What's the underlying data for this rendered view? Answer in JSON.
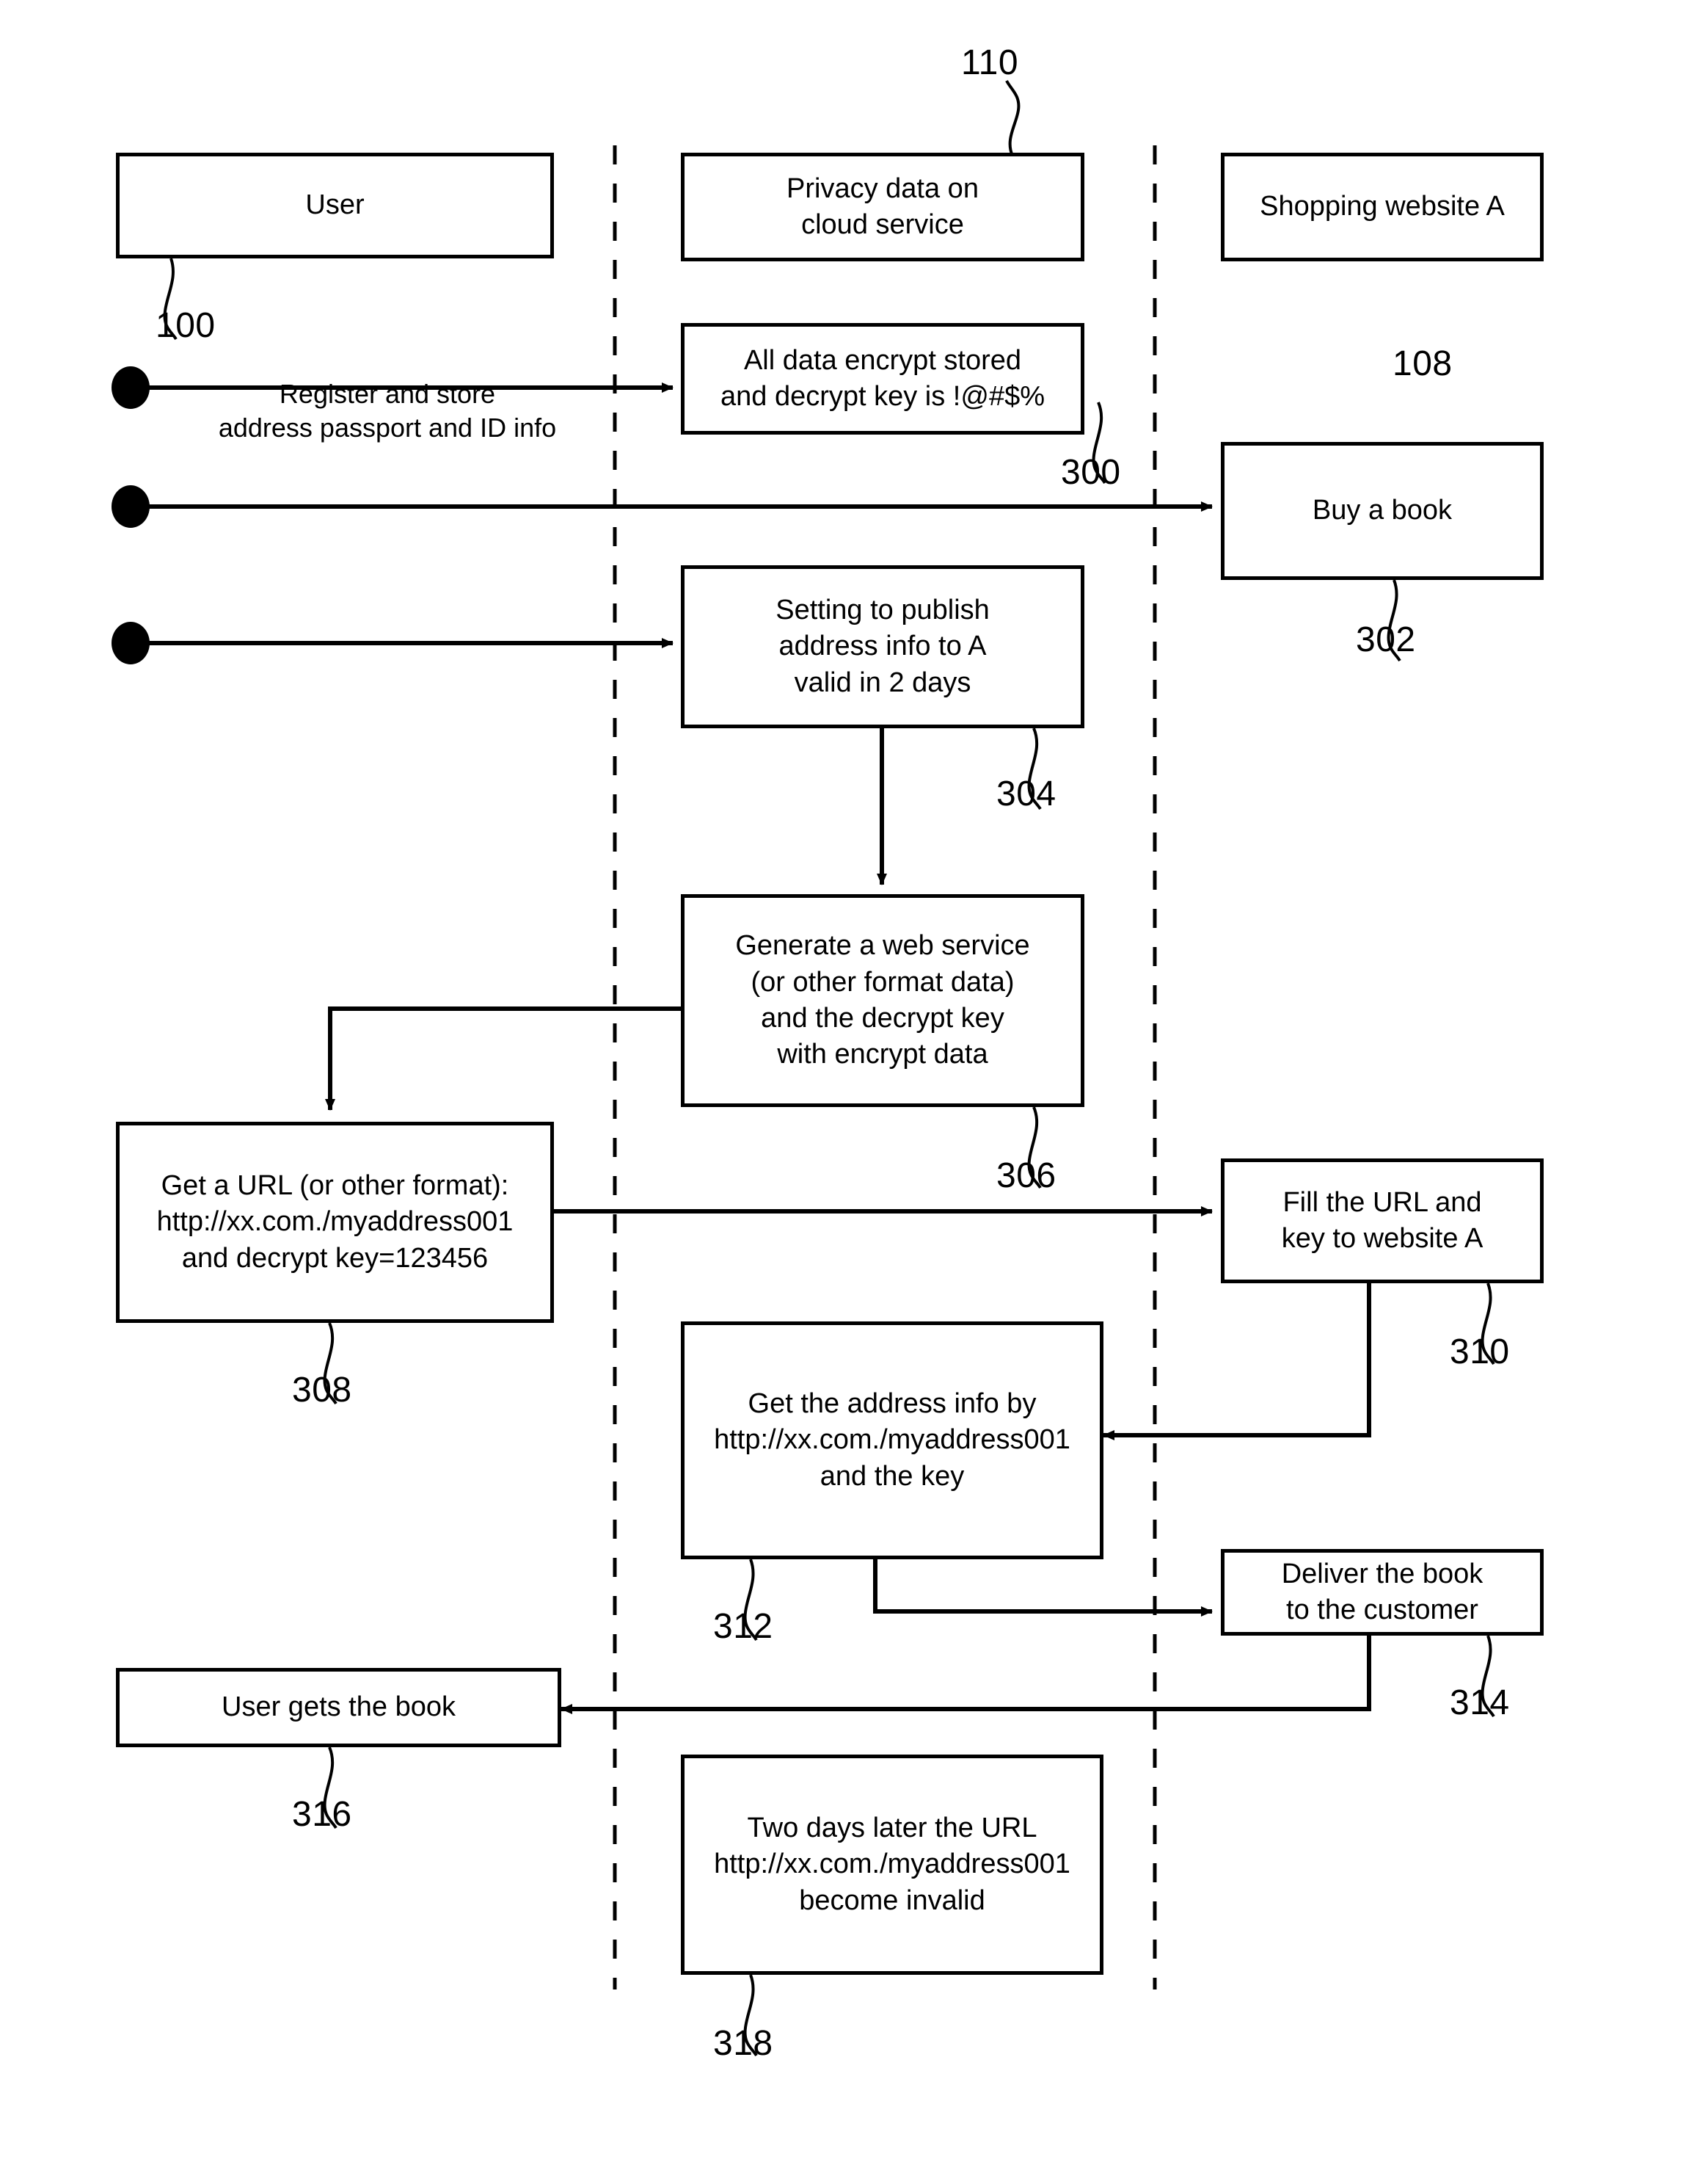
{
  "figure": {
    "type": "patent-flow-diagram",
    "lanes": [
      {
        "name": "user-lane",
        "label": "User"
      },
      {
        "name": "cloud-lane",
        "label": "Privacy data on\ncloud service"
      },
      {
        "name": "website-lane",
        "label": "Shopping website A"
      }
    ],
    "nodes": [
      {
        "id": "user",
        "label": "User",
        "ref": "100",
        "lane": "user-lane"
      },
      {
        "id": "privacy-data-cloud-service",
        "label": "Privacy data on\ncloud service",
        "ref": "110",
        "lane": "cloud-lane"
      },
      {
        "id": "shopping-website-a",
        "label": "Shopping website A",
        "ref": "108",
        "lane": "website-lane"
      },
      {
        "id": "all-data-encrypt-stored",
        "label": "All data encrypt stored\nand decrypt key is !@#$%",
        "ref": "300",
        "lane": "cloud-lane"
      },
      {
        "id": "buy-a-book",
        "label": "Buy a book",
        "ref": "302",
        "lane": "website-lane"
      },
      {
        "id": "setting-to-publish",
        "label": "Setting to publish\naddress info to A\nvalid in 2 days",
        "ref": "304",
        "lane": "cloud-lane"
      },
      {
        "id": "generate-a-web-service",
        "label": "Generate a web service\n(or other format data)\nand the decrypt key\nwith encrypt data",
        "ref": "306",
        "lane": "cloud-lane"
      },
      {
        "id": "get-a-url",
        "label": "Get a URL (or other format):\nhttp://xx.com./myaddress001\nand decrypt key=123456",
        "ref": "308",
        "lane": "user-lane"
      },
      {
        "id": "fill-the-url-and-key",
        "label": "Fill the URL and\nkey to website A",
        "ref": "310",
        "lane": "website-lane"
      },
      {
        "id": "get-the-address-info",
        "label": "Get the address info by\nhttp://xx.com./myaddress001\nand the key",
        "ref": "312",
        "lane": "cloud-lane"
      },
      {
        "id": "deliver-the-book",
        "label": "Deliver the book\nto the customer",
        "ref": "314",
        "lane": "website-lane"
      },
      {
        "id": "user-gets-the-book",
        "label": "User gets the book",
        "ref": "316",
        "lane": "user-lane"
      },
      {
        "id": "two-days-later-url-invalid",
        "label": "Two days later the URL\nhttp://xx.com./myaddress001\nbecome invalid",
        "ref": "318",
        "lane": "cloud-lane"
      }
    ],
    "edge_labels": [
      {
        "id": "register-and-store",
        "text": "Register and store\naddress passport and ID info"
      }
    ],
    "ref_numbers": [
      "100",
      "108",
      "110",
      "300",
      "302",
      "304",
      "306",
      "308",
      "310",
      "312",
      "314",
      "316",
      "318"
    ],
    "colors": {
      "stroke": "#000000",
      "background": "#ffffff"
    }
  }
}
